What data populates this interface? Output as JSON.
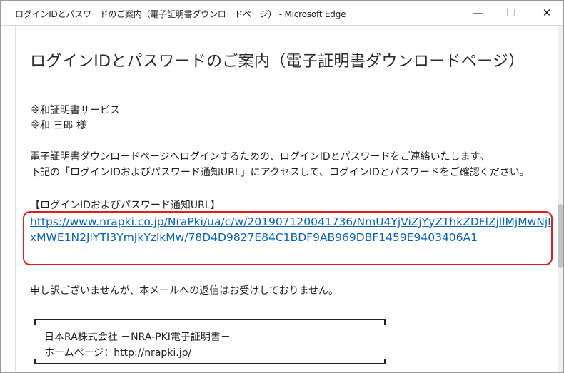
{
  "window": {
    "title": "ログインIDとパスワードのご案内（電子証明書ダウンロードページ） - Microsoft Edge",
    "min_glyph": "—",
    "max_glyph": "☐",
    "close_glyph": "✕"
  },
  "page": {
    "title": "ログインIDとパスワードのご案内（電子証明書ダウンロードページ）",
    "org": "令和証明書サービス",
    "recipient": "令和 三郎 様",
    "para1": "電子証明書ダウンロードページへログインするための、ログインIDとパスワードをご連絡いたします。",
    "para2": "下記の「ログインIDおよびパスワード通知URL」にアクセスして、ログインIDとパスワードをご確認ください。",
    "url_heading": "【ログインIDおよびパスワード通知URL】",
    "url": "https://www.nrapki.co.jp/NraPki/ua/c/w/201907120041736/NmU4YjViZjYyZThkZDFlZjllMjMwNjIxMWE1N2JlYTI3YmJkYzlkMw/78D4D9827E84C1BDF9AB969DBF1459E9403406A1",
    "noreply": "申し訳ございませんが、本メールへの返信はお受けしておりません。",
    "signature": {
      "line1": "日本RA株式会社 －NRA-PKI電子証明書－",
      "line2": "ホームページ：http://nrapki.jp/"
    }
  },
  "colors": {
    "link": "#0563c1",
    "highlight": "#e01e1e"
  }
}
